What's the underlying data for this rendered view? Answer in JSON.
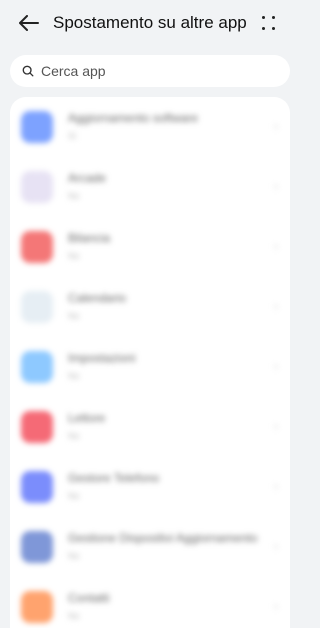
{
  "header": {
    "title": "Spostamento su altre app"
  },
  "search": {
    "placeholder": "Cerca app"
  },
  "apps": [
    {
      "name": "Aggiornamento software",
      "status": "Sì",
      "color": "#7da2ff"
    },
    {
      "name": "Arcade",
      "status": "No",
      "color": "#e7e2f4"
    },
    {
      "name": "Bilancia",
      "status": "No",
      "color": "#f47777"
    },
    {
      "name": "Calendario",
      "status": "No",
      "color": "#e6eef4"
    },
    {
      "name": "Impostazioni",
      "status": "No",
      "color": "#8ec9ff"
    },
    {
      "name": "Lettore",
      "status": "No",
      "color": "#f56a76"
    },
    {
      "name": "Gestore Telefono",
      "status": "No",
      "color": "#7b8dfc"
    },
    {
      "name": "Gestione Dispositivi Aggiornamento",
      "status": "No",
      "color": "#7f97d8"
    },
    {
      "name": "Contatti",
      "status": "No",
      "color": "#ffa36e"
    }
  ]
}
